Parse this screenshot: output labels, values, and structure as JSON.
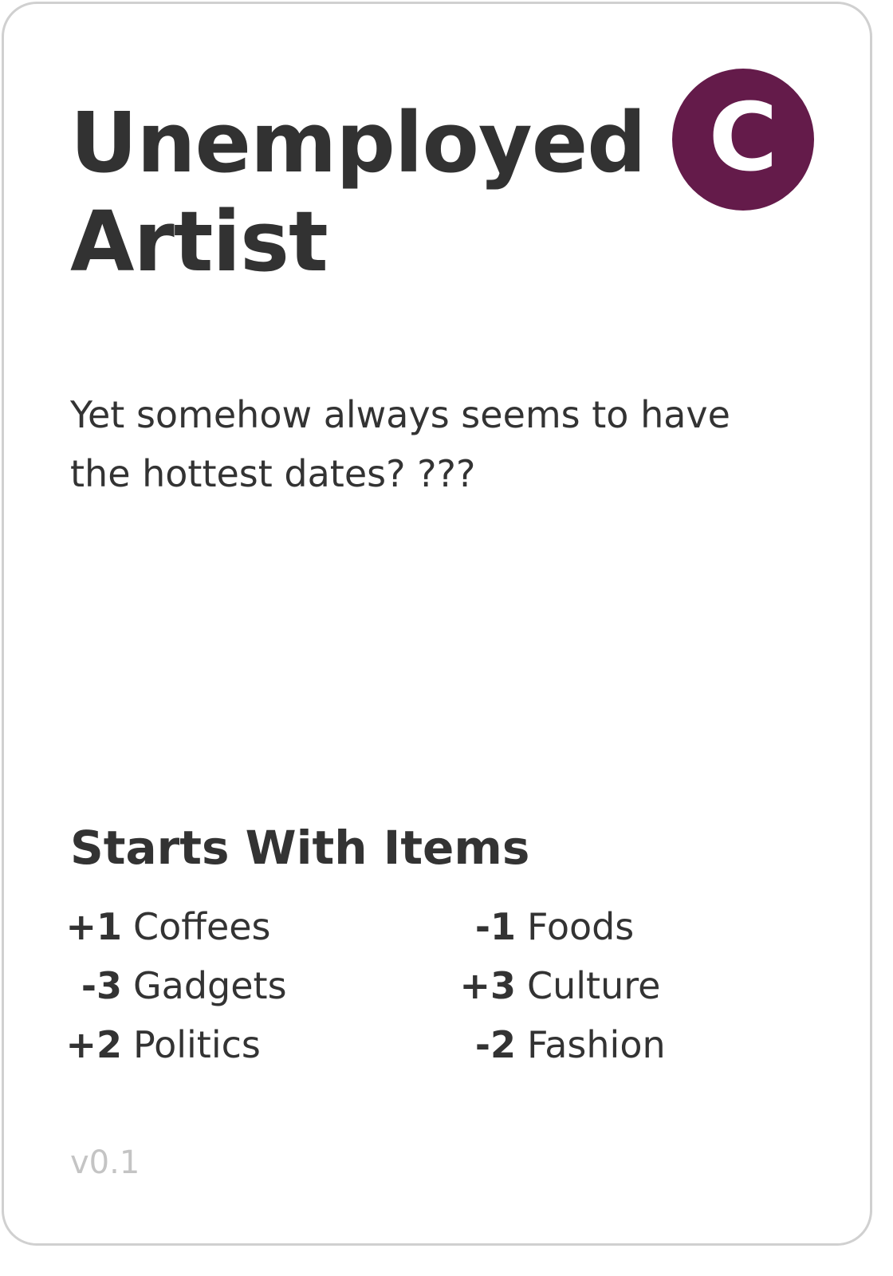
{
  "card": {
    "title_line1": "Unemployed",
    "title_line2": "Artist",
    "badge_letter": "C",
    "badge_color": "#641b4a",
    "description_line1": "Yet somehow always seems to have",
    "description_line2": "the hottest dates? ???",
    "items_heading": "Starts With Items",
    "items_left": [
      {
        "qty": "+1",
        "name": "Coffees"
      },
      {
        "qty": "-3",
        "name": "Gadgets"
      },
      {
        "qty": "+2",
        "name": "Politics"
      }
    ],
    "items_right": [
      {
        "qty": "-1",
        "name": "Foods"
      },
      {
        "qty": "+3",
        "name": "Culture"
      },
      {
        "qty": "-2",
        "name": "Fashion"
      }
    ],
    "version": "v0.1"
  }
}
